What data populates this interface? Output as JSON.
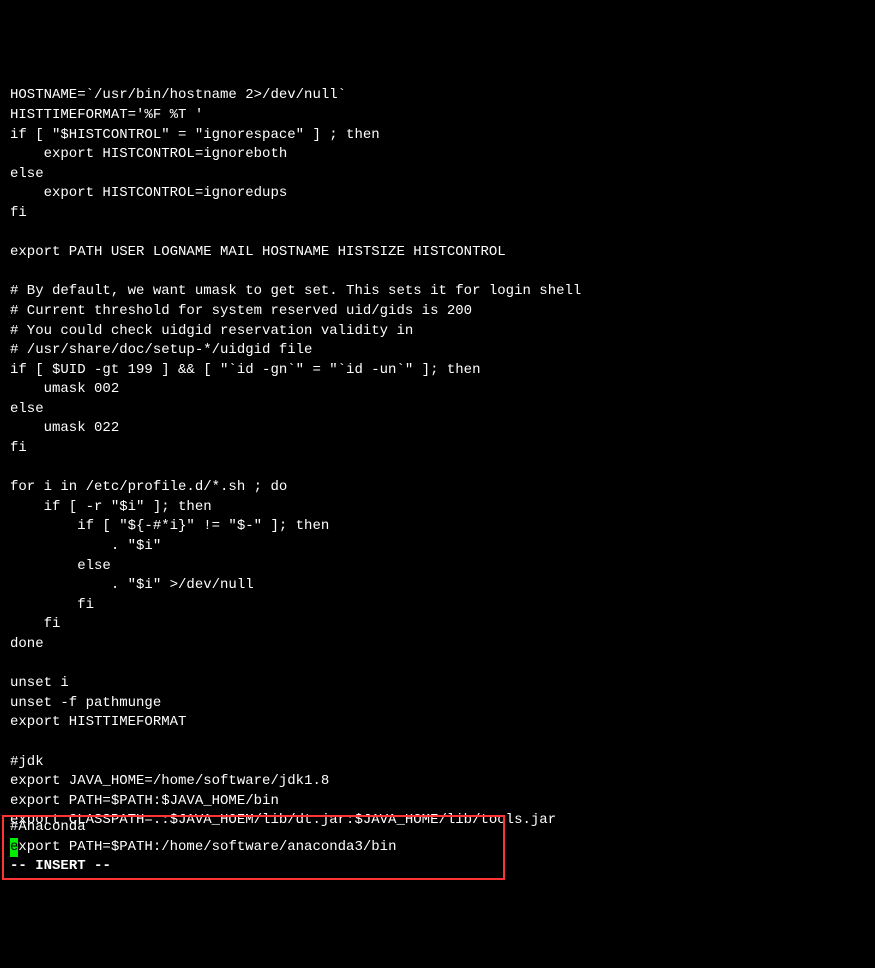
{
  "content": {
    "lines": [
      "HOSTNAME=`/usr/bin/hostname 2>/dev/null`",
      "HISTTIMEFORMAT='%F %T '",
      "if [ \"$HISTCONTROL\" = \"ignorespace\" ] ; then",
      "    export HISTCONTROL=ignoreboth",
      "else",
      "    export HISTCONTROL=ignoredups",
      "fi",
      "",
      "export PATH USER LOGNAME MAIL HOSTNAME HISTSIZE HISTCONTROL",
      "",
      "# By default, we want umask to get set. This sets it for login shell",
      "# Current threshold for system reserved uid/gids is 200",
      "# You could check uidgid reservation validity in",
      "# /usr/share/doc/setup-*/uidgid file",
      "if [ $UID -gt 199 ] && [ \"`id -gn`\" = \"`id -un`\" ]; then",
      "    umask 002",
      "else",
      "    umask 022",
      "fi",
      "",
      "for i in /etc/profile.d/*.sh ; do",
      "    if [ -r \"$i\" ]; then",
      "        if [ \"${-#*i}\" != \"$-\" ]; then",
      "            . \"$i\"",
      "        else",
      "            . \"$i\" >/dev/null",
      "        fi",
      "    fi",
      "done",
      "",
      "unset i",
      "unset -f pathmunge",
      "export HISTTIMEFORMAT",
      "",
      "#jdk",
      "export JAVA_HOME=/home/software/jdk1.8",
      "export PATH=$PATH:$JAVA_HOME/bin",
      "export CLASSPATH=.:$JAVA_HOEM/lib/dt.jar:$JAVA_HOME/lib/tools.jar"
    ]
  },
  "highlighted": {
    "line1": "#Anaconda",
    "cursor_char": "e",
    "line2_rest": "xport PATH=$PATH:/home/software/anaconda3/bin",
    "mode_prefix": "-- ",
    "mode_label": "INSERT",
    "mode_suffix": " --"
  }
}
